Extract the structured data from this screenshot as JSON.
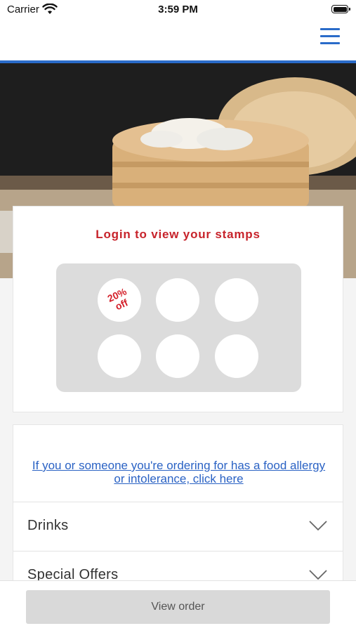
{
  "status_bar": {
    "carrier": "Carrier",
    "time": "3:59 PM",
    "wifi_icon": "wifi-icon",
    "battery_icon": "battery-icon"
  },
  "header": {
    "menu_icon": "hamburger-menu-icon",
    "accent_color": "#2a6bc9"
  },
  "hero": {
    "image": "bamboo steamer with dumplings"
  },
  "stamps": {
    "title": "Login to view your stamps",
    "title_color": "#c7232b",
    "reward_label": "20%\noff",
    "slots": [
      {
        "reward": true
      },
      {
        "reward": false
      },
      {
        "reward": false
      },
      {
        "reward": false
      },
      {
        "reward": false
      },
      {
        "reward": false
      }
    ]
  },
  "menu": {
    "allergy_link": "If you or someone you're ordering for has a food allergy or intolerance, click here",
    "categories": [
      {
        "label": "Drinks",
        "icon": "chevron-down-icon"
      },
      {
        "label": "Special Offers",
        "icon": "chevron-down-icon"
      }
    ]
  },
  "footer": {
    "view_order_label": "View order"
  }
}
